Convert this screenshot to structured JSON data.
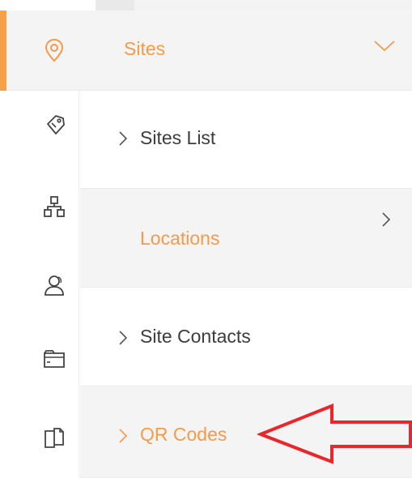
{
  "header": {
    "label": "Sites",
    "icon": "location-pin-icon",
    "accent_color": "#f7a04a"
  },
  "rail": {
    "icons": [
      "tag-icon",
      "sitemap-icon",
      "contacts-icon",
      "folder-icon",
      "documents-icon"
    ]
  },
  "menu": {
    "items": [
      {
        "label": "Sites List"
      },
      {
        "label": "Locations"
      },
      {
        "label": "Site Contacts"
      },
      {
        "label": "QR Codes"
      }
    ]
  },
  "colors": {
    "accent": "#f59a4a",
    "text": "#3c3c3c",
    "annotation_arrow": "#e8262b"
  }
}
